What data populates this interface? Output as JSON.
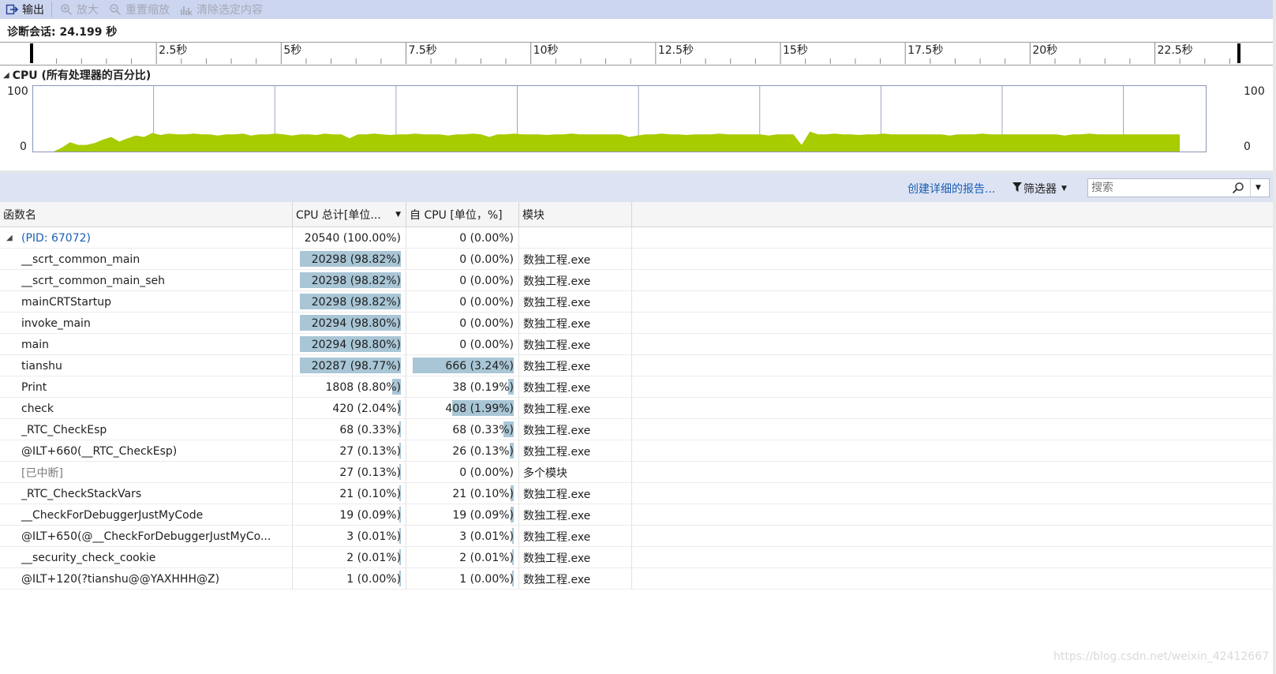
{
  "toolbar": {
    "output_label": "输出",
    "zoom_in_label": "放大",
    "reset_zoom_label": "重置缩放",
    "clear_selection_label": "清除选定内容"
  },
  "session": {
    "label": "诊断会话: 24.199 秒"
  },
  "ruler": {
    "ticks": [
      "2.5秒",
      "5秒",
      "7.5秒",
      "10秒",
      "12.5秒",
      "15秒",
      "17.5秒",
      "20秒",
      "22.5秒"
    ]
  },
  "cpu_graph": {
    "title": "CPU (所有处理器的百分比)",
    "y_max_label": "100",
    "y_min_label": "0",
    "color": "#a7cc00",
    "duration_seconds": 24.199,
    "values": [
      0,
      6,
      14,
      10,
      10,
      13,
      18,
      22,
      15,
      20,
      24,
      22,
      28,
      25,
      27,
      26,
      26,
      27,
      26,
      26,
      24,
      26,
      26,
      27,
      24,
      26,
      26,
      27,
      26,
      24,
      26,
      26,
      25,
      27,
      26,
      26,
      20,
      26,
      26,
      27,
      26,
      25,
      26,
      26,
      27,
      26,
      26,
      26,
      24,
      26,
      26,
      27,
      26,
      22,
      26,
      26,
      27,
      26,
      26,
      26,
      25,
      26,
      26,
      27,
      26,
      26,
      26,
      26,
      26,
      26,
      22,
      24,
      26,
      26,
      27,
      26,
      26,
      25,
      26,
      26,
      26,
      27,
      26,
      26,
      26,
      26,
      26,
      24,
      26,
      26,
      26,
      10,
      30,
      26,
      26,
      27,
      26,
      26,
      25,
      26,
      26,
      27,
      26,
      26,
      26,
      26,
      26,
      26,
      26,
      24,
      26,
      26,
      26,
      27,
      26,
      26,
      26,
      26,
      26,
      26,
      26,
      26,
      26,
      24,
      26,
      26,
      27,
      26,
      26,
      26,
      26,
      26,
      26,
      26,
      26,
      26,
      26,
      26
    ]
  },
  "report_bar": {
    "report_link": "创建详细的报告...",
    "filter_label": "筛选器",
    "search_placeholder": "搜索"
  },
  "table": {
    "columns": [
      "函数名",
      "CPU 总计[单位...",
      "自 CPU [单位，%]",
      "模块"
    ],
    "rows": [
      {
        "name": "(PID: 67072)",
        "total": "20540 (100.00%)",
        "total_pct": 100.0,
        "self": "0 (0.00%)",
        "self_pct": 0.0,
        "module": ""
      },
      {
        "name": "__scrt_common_main",
        "total": "20298 (98.82%)",
        "total_pct": 98.82,
        "self": "0 (0.00%)",
        "self_pct": 0.0,
        "module": "数独工程.exe"
      },
      {
        "name": "__scrt_common_main_seh",
        "total": "20298 (98.82%)",
        "total_pct": 98.82,
        "self": "0 (0.00%)",
        "self_pct": 0.0,
        "module": "数独工程.exe"
      },
      {
        "name": "mainCRTStartup",
        "total": "20298 (98.82%)",
        "total_pct": 98.82,
        "self": "0 (0.00%)",
        "self_pct": 0.0,
        "module": "数独工程.exe"
      },
      {
        "name": "invoke_main",
        "total": "20294 (98.80%)",
        "total_pct": 98.8,
        "self": "0 (0.00%)",
        "self_pct": 0.0,
        "module": "数独工程.exe"
      },
      {
        "name": "main",
        "total": "20294 (98.80%)",
        "total_pct": 98.8,
        "self": "0 (0.00%)",
        "self_pct": 0.0,
        "module": "数独工程.exe"
      },
      {
        "name": "tianshu",
        "total": "20287 (98.77%)",
        "total_pct": 98.77,
        "self": "666 (3.24%)",
        "self_pct": 100.0,
        "module": "数独工程.exe"
      },
      {
        "name": "Print",
        "total": "1808 (8.80%)",
        "total_pct": 8.8,
        "self": "38 (0.19%)",
        "self_pct": 5.7,
        "module": "数独工程.exe"
      },
      {
        "name": "check",
        "total": "420 (2.04%)",
        "total_pct": 2.04,
        "self": "408 (1.99%)",
        "self_pct": 61.3,
        "module": "数独工程.exe"
      },
      {
        "name": "_RTC_CheckEsp",
        "total": "68 (0.33%)",
        "total_pct": 0.33,
        "self": "68 (0.33%)",
        "self_pct": 10.2,
        "module": "数独工程.exe"
      },
      {
        "name": "@ILT+660(__RTC_CheckEsp)",
        "total": "27 (0.13%)",
        "total_pct": 0.13,
        "self": "26 (0.13%)",
        "self_pct": 3.9,
        "module": "数独工程.exe"
      },
      {
        "name": "[已中断]",
        "total": "27 (0.13%)",
        "total_pct": 0.13,
        "self": "0 (0.00%)",
        "self_pct": 0.0,
        "module": "多个模块"
      },
      {
        "name": "_RTC_CheckStackVars",
        "total": "21 (0.10%)",
        "total_pct": 0.1,
        "self": "21 (0.10%)",
        "self_pct": 3.2,
        "module": "数独工程.exe"
      },
      {
        "name": "__CheckForDebuggerJustMyCode",
        "total": "19 (0.09%)",
        "total_pct": 0.09,
        "self": "19 (0.09%)",
        "self_pct": 2.9,
        "module": "数独工程.exe"
      },
      {
        "name": "@ILT+650(@__CheckForDebuggerJustMyCo...",
        "total": "3 (0.01%)",
        "total_pct": 0.01,
        "self": "3 (0.01%)",
        "self_pct": 0.5,
        "module": "数独工程.exe"
      },
      {
        "name": "__security_check_cookie",
        "total": "2 (0.01%)",
        "total_pct": 0.01,
        "self": "2 (0.01%)",
        "self_pct": 0.3,
        "module": "数独工程.exe"
      },
      {
        "name": "@ILT+120(?tianshu@@YAXHHH@Z)",
        "total": "1 (0.00%)",
        "total_pct": 0.0,
        "self": "1 (0.00%)",
        "self_pct": 0.2,
        "module": "数独工程.exe"
      }
    ]
  },
  "watermark": "https://blog.csdn.net/weixin_42412667"
}
